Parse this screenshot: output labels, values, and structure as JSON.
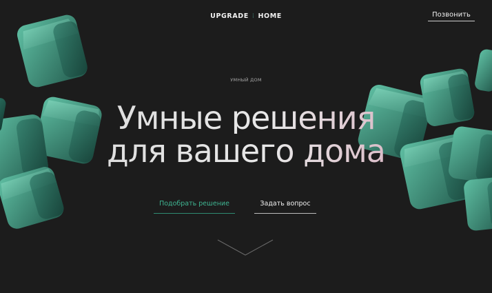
{
  "header": {
    "logo_left": "UPGRADE",
    "logo_sep": "⁞",
    "logo_right": "HOME",
    "call_label": "Позвонить"
  },
  "hero": {
    "eyebrow": "УМНЫЙ ДОМ",
    "title_line1": "Умные решения",
    "title_line2": "для вашего дома",
    "primary_cta": "Подобрать решение",
    "secondary_cta": "Задать вопрос"
  },
  "icons": {
    "scroll": "chevron-down-icon",
    "decor": "cube-icon"
  },
  "colors": {
    "background": "#1c1c1c",
    "accent_green": "#3fb592",
    "cube_dark": "#1d4a40",
    "cube_light": "#6fcdb2",
    "title_pink": "#d9b7c4"
  }
}
